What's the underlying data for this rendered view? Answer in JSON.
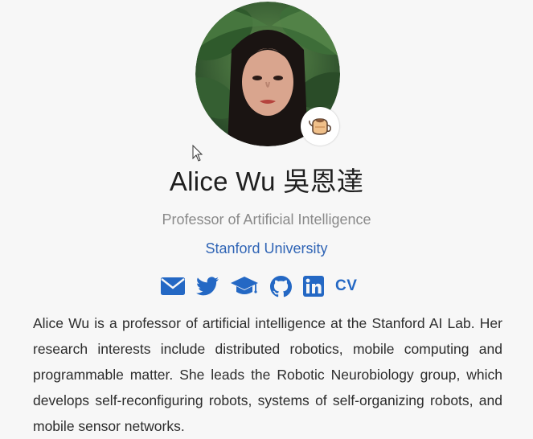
{
  "profile": {
    "name": "Alice Wu 吳恩達",
    "role": "Professor of Artificial Intelligence",
    "organization": "Stanford University",
    "bio": "Alice Wu is a professor of artificial intelligence at the Stanford AI Lab. Her research interests include distributed robotics, mobile computing and programmable matter. She leads the Robotic Neurobiology group, which develops self-reconfiguring robots, systems of self-organizing robots, and mobile sensor networks.",
    "avatar_icon": "portrait-photo",
    "status_emoji_icon": "teapot-emoji-icon"
  },
  "social": {
    "items": [
      {
        "icon": "envelope-icon"
      },
      {
        "icon": "twitter-icon"
      },
      {
        "icon": "graduation-cap-icon"
      },
      {
        "icon": "github-icon"
      },
      {
        "icon": "linkedin-icon"
      }
    ],
    "cv_label": "CV"
  },
  "colors": {
    "background": "#f7f7f7",
    "accent": "#2468c4",
    "muted_text": "#8a8a8a"
  }
}
